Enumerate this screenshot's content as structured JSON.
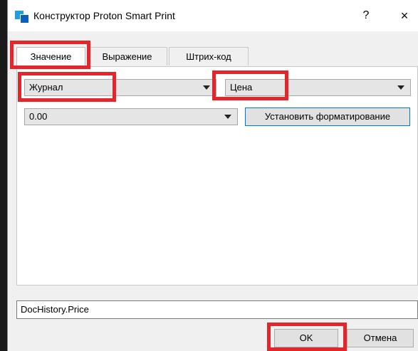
{
  "window": {
    "title": "Конструктор Proton Smart Print",
    "help_glyph": "?",
    "close_glyph": "×"
  },
  "tabs": [
    {
      "label": "Значение",
      "active": true
    },
    {
      "label": "Выражение",
      "active": false
    },
    {
      "label": "Штрих-код",
      "active": false
    }
  ],
  "value_tab": {
    "source_select": {
      "value": "Журнал"
    },
    "field_select": {
      "value": "Цена"
    },
    "format_select": {
      "value": "0.00"
    },
    "format_button_label": "Установить форматирование"
  },
  "expression": {
    "value": "DocHistory.Price"
  },
  "footer": {
    "ok_label": "OK",
    "cancel_label": "Отмена"
  },
  "colors": {
    "highlight": "#e3262c",
    "focus_border": "#0078d7",
    "logo_light": "#1aa0e8",
    "logo_dark": "#0a5fbf"
  },
  "icons": [
    "app-logo-icon",
    "help-icon",
    "close-icon",
    "chevron-down-icon"
  ]
}
